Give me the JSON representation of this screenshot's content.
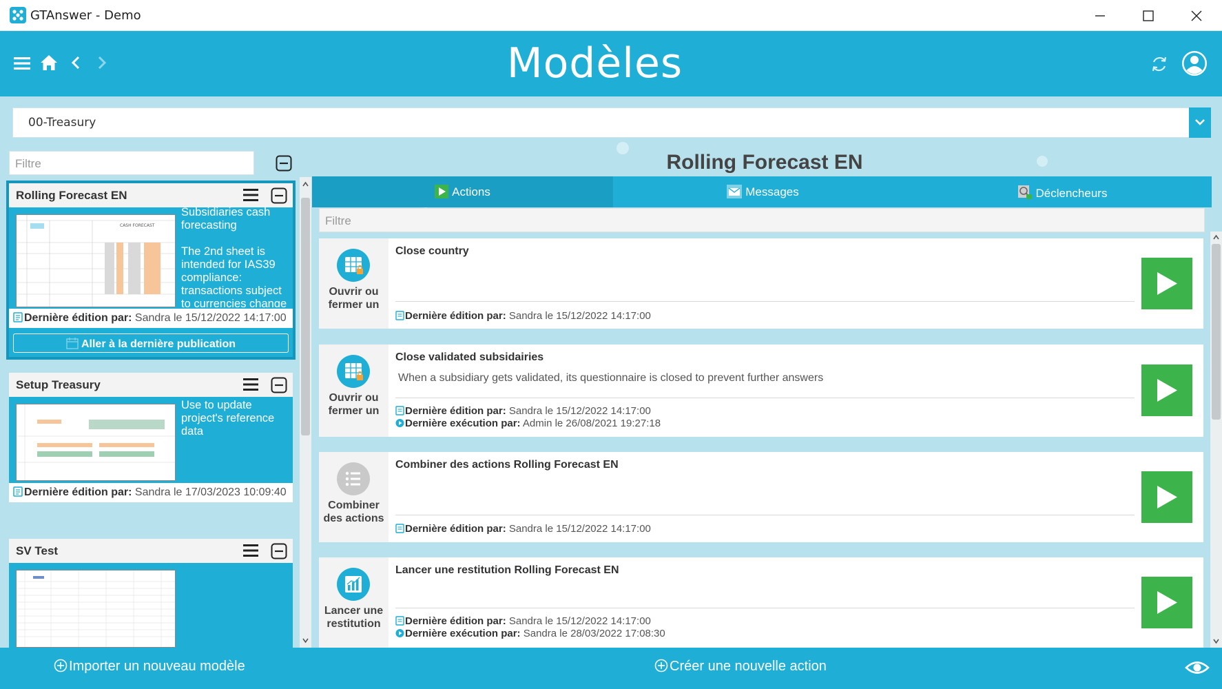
{
  "window": {
    "title": "GTAnswer - Demo",
    "controls": [
      "minimize-icon",
      "maximize-icon",
      "close-icon"
    ]
  },
  "header": {
    "title": "Modèles",
    "left_icons": [
      "menu-icon",
      "home-icon",
      "back-icon",
      "forward-icon"
    ],
    "right_icons": [
      "refresh-icon",
      "user-avatar-icon"
    ]
  },
  "project_select": {
    "value": "00-Treasury"
  },
  "left_panel": {
    "filter_placeholder": "Filtre",
    "models": [
      {
        "title": "Rolling Forecast EN",
        "selected": true,
        "desc_lines": [
          "Subsidiaries cash forecasting",
          "The 2nd sheet is intended for IAS39 compliance: transactions subject to currencies change"
        ],
        "edit_label": "Dernière édition par:",
        "edit_value": " Sandra le 15/12/2022 14:17:00",
        "goto_label": "Aller à la dernière publication"
      },
      {
        "title": "Setup Treasury",
        "desc_lines": [
          "Use to update project's reference data"
        ],
        "edit_label": "Dernière édition par:",
        "edit_value": " Sandra le 17/03/2023 10:09:40"
      },
      {
        "title": "SV Test"
      }
    ]
  },
  "right_panel": {
    "model_title": "Rolling Forecast EN",
    "tabs": [
      {
        "label": "Actions",
        "icon": "play-icon",
        "active": true
      },
      {
        "label": "Messages",
        "icon": "envelope-icon"
      },
      {
        "label": "Déclencheurs",
        "icon": "trigger-icon"
      }
    ],
    "filter_placeholder": "Filtre",
    "actions": [
      {
        "type_label": "Ouvrir ou fermer un",
        "icon": "table-lock-icon",
        "name": "Close country",
        "description": "",
        "edited_label": "Dernière édition par:",
        "edited_value": " Sandra le 15/12/2022 14:17:00"
      },
      {
        "type_label": "Ouvrir ou fermer un",
        "icon": "table-lock-icon",
        "name": "Close validated subsidairies",
        "description": "When a subsidiary gets validated, its questionnaire is closed to prevent further answers",
        "edited_label": "Dernière édition par:",
        "edited_value": " Sandra le 15/12/2022 14:17:00",
        "executed_label": "Dernière exécution par:",
        "executed_value": " Admin le 26/08/2021 19:27:18"
      },
      {
        "type_label": "Combiner des actions",
        "icon": "list-icon",
        "name": "Combiner des actions Rolling Forecast EN",
        "description": "",
        "edited_label": "Dernière édition par:",
        "edited_value": " Sandra le 15/12/2022 14:17:00"
      },
      {
        "type_label": "Lancer une restitution",
        "icon": "chart-icon",
        "name": "Lancer une restitution Rolling Forecast EN",
        "description": "",
        "edited_label": "Dernière édition par:",
        "edited_value": " Sandra le 15/12/2022 14:17:00",
        "executed_label": "Dernière exécution par:",
        "executed_value": " Sandra le 28/03/2022 17:08:30"
      }
    ]
  },
  "footer": {
    "import_label": "Importer un nouveau modèle",
    "create_label": "Créer une nouvelle action",
    "eye_icon": "eye-icon"
  },
  "colors": {
    "primary": "#1eaed6",
    "active_tab": "#1a9ec4",
    "run_button": "#3cb44b",
    "background": "#b7e1ec"
  }
}
